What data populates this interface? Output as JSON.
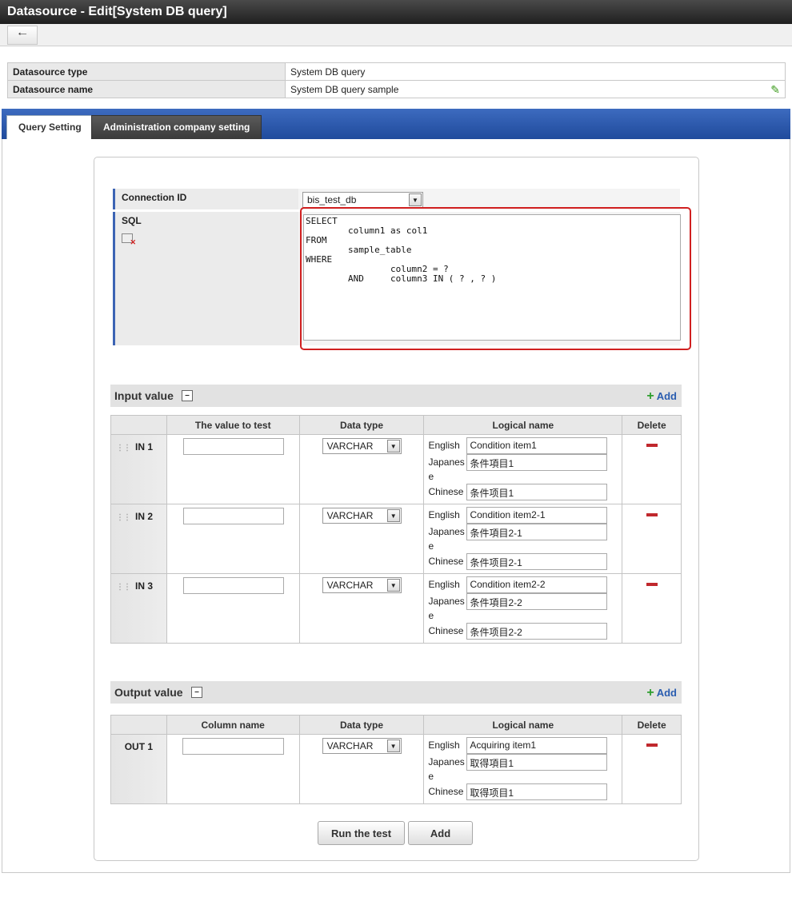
{
  "window": {
    "title": "Datasource - Edit[System DB query]"
  },
  "toolbar": {
    "back_icon": "arrow-left-icon"
  },
  "info": {
    "rows": [
      {
        "label": "Datasource type",
        "value": "System DB query"
      },
      {
        "label": "Datasource name",
        "value": "System DB query sample"
      }
    ]
  },
  "tabs": [
    {
      "label": "Query Setting",
      "active": true
    },
    {
      "label": "Administration company setting",
      "active": false
    }
  ],
  "form": {
    "connection_label": "Connection ID",
    "connection_value": "bis_test_db",
    "sql_label": "SQL",
    "sql_text": "SELECT\n        column1 as col1\nFROM\n        sample_table\nWHERE\n                column2 = ?\n        AND     column3 IN ( ? , ? )"
  },
  "input_section": {
    "title": "Input value",
    "add_label": "Add",
    "headers": [
      "",
      "The value to test",
      "Data type",
      "Logical name",
      "Delete"
    ],
    "rows": [
      {
        "id": "IN 1",
        "test_value": "",
        "data_type": "VARCHAR",
        "english": "Condition item1",
        "japanese": "条件項目1",
        "chinese": "条件项目1"
      },
      {
        "id": "IN 2",
        "test_value": "",
        "data_type": "VARCHAR",
        "english": "Condition item2-1",
        "japanese": "条件項目2-1",
        "chinese": "条件项目2-1"
      },
      {
        "id": "IN 3",
        "test_value": "",
        "data_type": "VARCHAR",
        "english": "Condition item2-2",
        "japanese": "条件項目2-2",
        "chinese": "条件项目2-2"
      }
    ]
  },
  "output_section": {
    "title": "Output value",
    "add_label": "Add",
    "headers": [
      "",
      "Column name",
      "Data type",
      "Logical name",
      "Delete"
    ],
    "rows": [
      {
        "id": "OUT 1",
        "column_name": "",
        "data_type": "VARCHAR",
        "english": "Acquiring item1",
        "japanese": "取得項目1",
        "chinese": "取得项目1"
      }
    ]
  },
  "lang_labels": {
    "english": "English",
    "japanese": "Japanese",
    "chinese": "Chinese"
  },
  "buttons": {
    "run_test": "Run the test",
    "add": "Add"
  },
  "colors": {
    "accent_blue": "#1f4a9c",
    "delete_red": "#c0282d",
    "highlight_red": "#d02020",
    "add_green": "#2f9e2f"
  }
}
